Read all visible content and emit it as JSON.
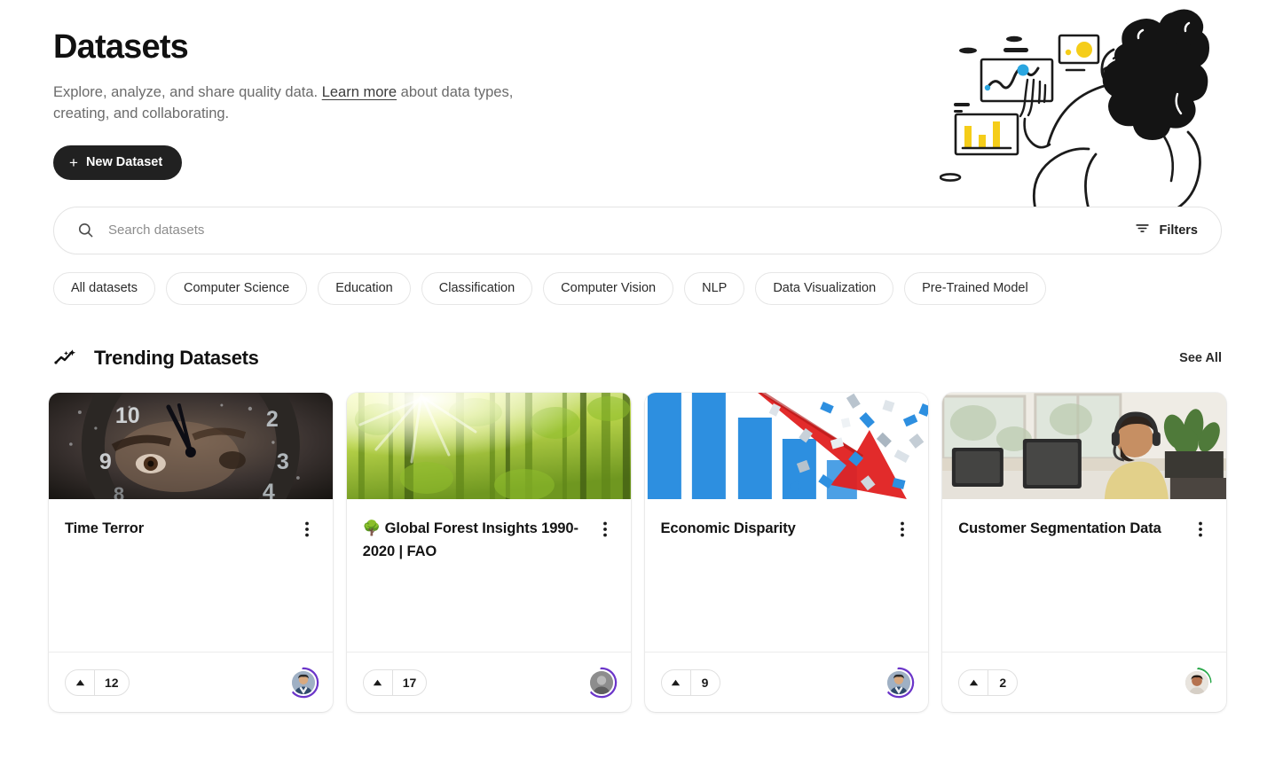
{
  "hero": {
    "title": "Datasets",
    "subtitle_before": "Explore, analyze, and share quality data. ",
    "learn_more": "Learn more",
    "subtitle_after": " about data types, creating, and collaborating.",
    "new_dataset_label": "New Dataset",
    "plus_icon": "plus-icon",
    "illustration": "woman-analyzing-dashboards-illustration"
  },
  "search": {
    "placeholder": "Search datasets",
    "value": "",
    "icon": "search-icon",
    "filters_label": "Filters",
    "filters_icon": "filter-icon"
  },
  "tags": [
    {
      "label": "All datasets",
      "active": true
    },
    {
      "label": "Computer Science",
      "active": false
    },
    {
      "label": "Education",
      "active": false
    },
    {
      "label": "Classification",
      "active": false
    },
    {
      "label": "Computer Vision",
      "active": false
    },
    {
      "label": "NLP",
      "active": false
    },
    {
      "label": "Data Visualization",
      "active": false
    },
    {
      "label": "Pre-Trained Model",
      "active": false
    }
  ],
  "trending": {
    "icon": "trending-sparkle-icon",
    "title": "Trending Datasets",
    "see_all_label": "See All"
  },
  "cards": [
    {
      "title": "Time Terror",
      "thumbnail": "clock-face-eye-photo",
      "votes": "12",
      "menu_icon": "more-vertical-icon",
      "upvote_icon": "caret-up-icon",
      "avatar": "user-avatar-purple-ring",
      "ring_color": "#6b35c9"
    },
    {
      "title": "🌳 Global Forest Insights 1990-2020 | FAO",
      "thumbnail": "sunlit-forest-photo",
      "votes": "17",
      "menu_icon": "more-vertical-icon",
      "upvote_icon": "caret-up-icon",
      "avatar": "user-avatar-purple-ring",
      "ring_color": "#6b35c9"
    },
    {
      "title": "Economic Disparity",
      "thumbnail": "shattering-bar-chart-photo",
      "votes": "9",
      "menu_icon": "more-vertical-icon",
      "upvote_icon": "caret-up-icon",
      "avatar": "user-avatar-purple-ring",
      "ring_color": "#6b35c9"
    },
    {
      "title": "Customer Segmentation Data",
      "thumbnail": "call-center-agent-photo",
      "votes": "2",
      "menu_icon": "more-vertical-icon",
      "upvote_icon": "caret-up-icon",
      "avatar": "user-avatar-green-ring",
      "ring_color": "#2aa84a"
    }
  ],
  "colors": {
    "accent_dark": "#212121",
    "text_primary": "#141414",
    "text_muted": "#6b6b6b",
    "border": "#e6e6e6"
  }
}
